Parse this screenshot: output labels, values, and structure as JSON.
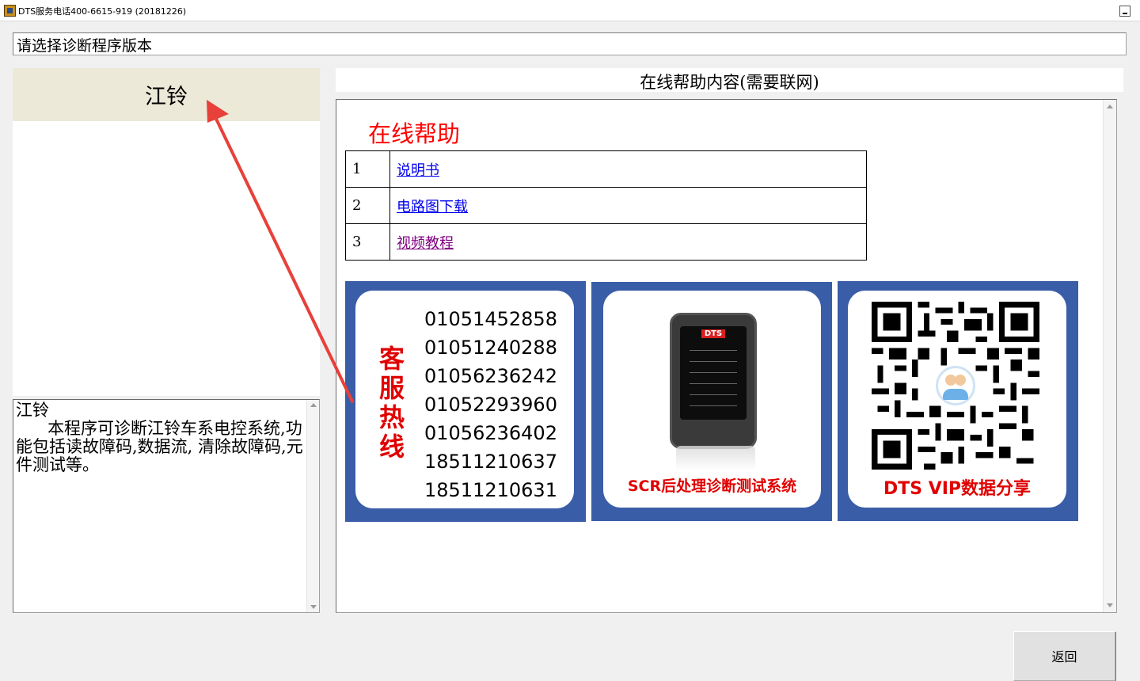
{
  "window": {
    "title": "DTS服务电话400-6615-919 (20181226)",
    "icon": "app-icon"
  },
  "prompt": "请选择诊断程序版本",
  "program_list": {
    "items": [
      {
        "label": "江铃",
        "selected": true
      }
    ]
  },
  "description": {
    "text": "江铃\n      本程序可诊断江铃车系电控系统,功能包括读故障码,数据流, 清除故障码,元件测试等。"
  },
  "help": {
    "header": "在线帮助内容(需要联网)",
    "title": "在线帮助",
    "links": [
      {
        "num": "1",
        "label": "说明书",
        "visited": false
      },
      {
        "num": "2",
        "label": "电路图下载",
        "visited": false
      },
      {
        "num": "3",
        "label": "视频教程",
        "visited": true
      }
    ],
    "banners": {
      "hotline": {
        "label": "客服热线",
        "phones": [
          "01051452858",
          "01051240288",
          "01056236242",
          "01052293960",
          "01056236402",
          "18511210637",
          "18511210631"
        ]
      },
      "device": {
        "logo": "DTS",
        "caption": "SCR后处理诊断测试系统"
      },
      "qr": {
        "caption": "DTS  VIP数据分享"
      }
    }
  },
  "buttons": {
    "back": "返回"
  },
  "colors": {
    "banner_bg": "#3a5da8",
    "accent_red": "#e00000",
    "selected_row": "#ece9d8",
    "link": "#0000ee",
    "visited_link": "#800080",
    "annotation_arrow": "#e8403a"
  }
}
